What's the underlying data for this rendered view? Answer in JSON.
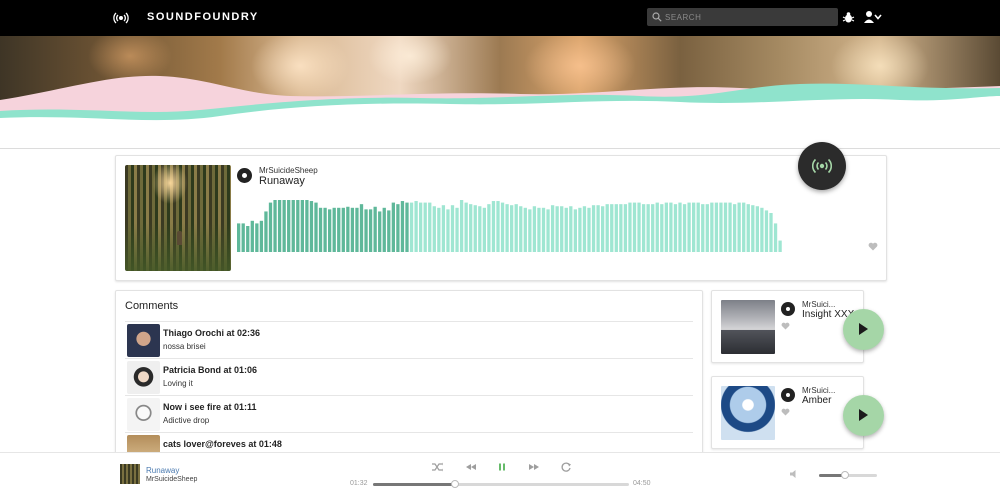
{
  "app": {
    "name": "SOUNDFOUNDRY"
  },
  "search": {
    "placeholder": "SEARCH",
    "value": ""
  },
  "header": {
    "icons": [
      "broadcast-icon",
      "search-icon",
      "bug-icon",
      "user-icon",
      "chevron-down-icon"
    ]
  },
  "colors": {
    "played": "#5fb89a",
    "unplayed": "#9fe6d2",
    "play_button": "#a5d6a7",
    "link": "#4a7ab0"
  },
  "track": {
    "artist": "MrSuicideSheep",
    "title": "Runaway",
    "waveform_progress": 0.32,
    "waveform": [
      0.55,
      0.55,
      0.5,
      0.6,
      0.55,
      0.6,
      0.78,
      0.95,
      1.0,
      1.0,
      1.0,
      1.0,
      1.0,
      1.0,
      1.0,
      1.0,
      0.98,
      0.95,
      0.85,
      0.85,
      0.82,
      0.85,
      0.85,
      0.85,
      0.87,
      0.85,
      0.85,
      0.92,
      0.82,
      0.82,
      0.87,
      0.78,
      0.85,
      0.8,
      0.95,
      0.92,
      0.98,
      0.95,
      0.95,
      0.98,
      0.95,
      0.95,
      0.95,
      0.88,
      0.85,
      0.9,
      0.82,
      0.9,
      0.85,
      1.0,
      0.95,
      0.92,
      0.9,
      0.88,
      0.85,
      0.92,
      0.98,
      0.98,
      0.95,
      0.92,
      0.9,
      0.92,
      0.88,
      0.85,
      0.82,
      0.88,
      0.85,
      0.85,
      0.82,
      0.9,
      0.88,
      0.88,
      0.85,
      0.88,
      0.82,
      0.85,
      0.88,
      0.85,
      0.9,
      0.9,
      0.88,
      0.92,
      0.92,
      0.92,
      0.92,
      0.92,
      0.95,
      0.95,
      0.95,
      0.92,
      0.92,
      0.92,
      0.95,
      0.92,
      0.95,
      0.95,
      0.92,
      0.95,
      0.92,
      0.95,
      0.95,
      0.95,
      0.92,
      0.92,
      0.95,
      0.95,
      0.95,
      0.95,
      0.95,
      0.92,
      0.95,
      0.95,
      0.92,
      0.9,
      0.88,
      0.85,
      0.8,
      0.75,
      0.55,
      0.22
    ]
  },
  "comments": {
    "title": "Comments",
    "items": [
      {
        "head": "Thiago Orochi at 02:36",
        "text": "nossa brisei"
      },
      {
        "head": "Patricia Bond at 01:06",
        "text": "Loving it"
      },
      {
        "head": "Now i see fire at 01:11",
        "text": "Adictive drop"
      },
      {
        "head": "cats lover@foreves at 01:48",
        "text": ""
      }
    ]
  },
  "related": [
    {
      "artist": "MrSuici...",
      "title": "Insight XXX"
    },
    {
      "artist": "MrSuici...",
      "title": "Amber"
    }
  ],
  "player": {
    "title": "Runaway",
    "artist": "MrSuicideSheep",
    "current_time": "01:32",
    "total_time": "04:50",
    "progress": 0.32,
    "volume": 0.45,
    "state": "playing"
  }
}
